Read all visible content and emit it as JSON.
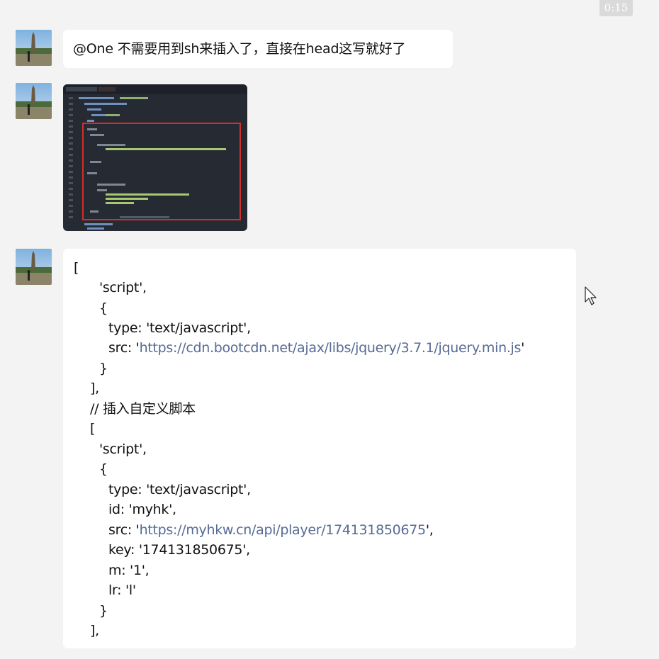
{
  "timestamp": "0:15",
  "messages": {
    "text1": "@One 不需要用到sh来插入了，直接在head这写就好了",
    "code": {
      "l1": "[",
      "l2": "'script',",
      "l3": "{",
      "l4": "type: 'text/javascript',",
      "l5_prefix": "src: '",
      "l5_link": "https://cdn.bootcdn.net/ajax/libs/jquery/3.7.1/jquery.min.js",
      "l5_suffix": "'",
      "l6": "}",
      "l7": "],",
      "l8": "// 插入自定义脚本",
      "l9": "[",
      "l10": "'script',",
      "l11": "{",
      "l12": "type: 'text/javascript',",
      "l13": "id: 'myhk',",
      "l14_prefix": "src: '",
      "l14_link": "https://myhkw.cn/api/player/174131850675",
      "l14_suffix": "',",
      "l15": "key: '174131850675',",
      "l16": "m: '1',",
      "l17": "lr: 'l'",
      "l18": "}",
      "l19": "],"
    }
  },
  "icons": {
    "avatar": "avatar-pagoda-photo",
    "cursor": "mouse-pointer-icon"
  },
  "colors": {
    "background": "#f3f3f3",
    "bubble": "#ffffff",
    "link": "#576b95",
    "editor_bg": "#262a33",
    "highlight_box": "#d0302b"
  }
}
